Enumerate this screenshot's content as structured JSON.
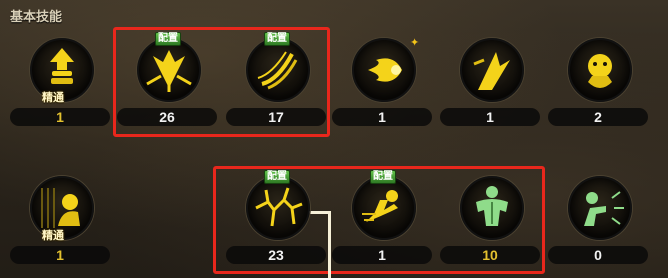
{
  "panel": {
    "title": "基本技能"
  },
  "badge_label": "配置",
  "mastery_label": "精通",
  "colors": {
    "highlight": "#e8271c",
    "badge": "#4aa835",
    "gold_level": "#e3c12f",
    "icon_glow": "#f4d31a",
    "mastery_icon": "#8fdc8a"
  },
  "row1": [
    {
      "icon": "fist-up-arrow-icon",
      "badge": false,
      "mastery": true,
      "level": "1",
      "level_style": "gold"
    },
    {
      "icon": "down-burst-icon",
      "badge": true,
      "mastery": false,
      "level": "26",
      "level_style": "white"
    },
    {
      "icon": "claw-slash-icon",
      "badge": true,
      "mastery": false,
      "level": "17",
      "level_style": "white"
    },
    {
      "icon": "fireball-icon",
      "badge": false,
      "mastery": false,
      "level": "1",
      "level_style": "white",
      "sparkle": true
    },
    {
      "icon": "rising-strike-icon",
      "badge": false,
      "mastery": false,
      "level": "1",
      "level_style": "white"
    },
    {
      "icon": "tiger-spirit-icon",
      "badge": false,
      "mastery": false,
      "level": "2",
      "level_style": "white"
    }
  ],
  "row2": [
    {
      "icon": "palm-strike-icon",
      "badge": false,
      "mastery": true,
      "level": "1",
      "level_style": "gold"
    },
    {
      "icon": "ground-crack-icon",
      "badge": true,
      "mastery": false,
      "level": "23",
      "level_style": "white"
    },
    {
      "icon": "dash-kick-icon",
      "badge": true,
      "mastery": false,
      "level": "1",
      "level_style": "white"
    },
    {
      "icon": "muscle-body-icon",
      "badge": false,
      "mastery": false,
      "level": "10",
      "level_style": "gold"
    },
    {
      "icon": "shockwave-punch-icon",
      "badge": false,
      "mastery": false,
      "level": "0",
      "level_style": "white"
    }
  ]
}
